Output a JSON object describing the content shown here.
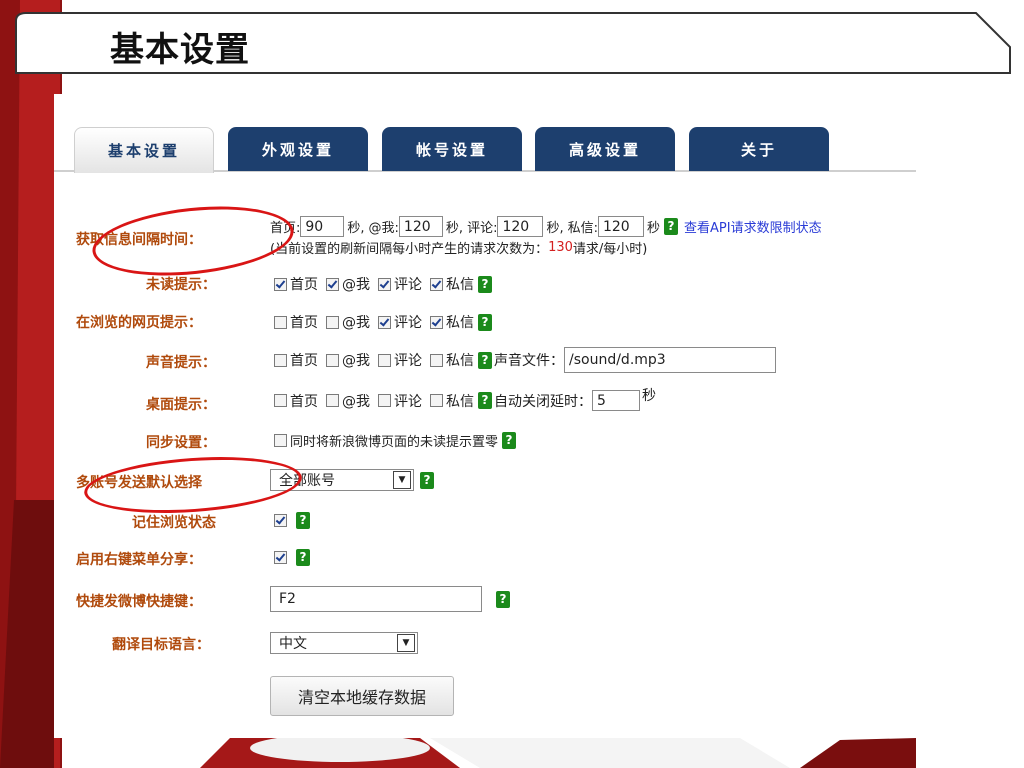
{
  "slide": {
    "title": "基本设置"
  },
  "tabs": [
    {
      "label": "基本设置",
      "active": true
    },
    {
      "label": "外观设置",
      "active": false
    },
    {
      "label": "帐号设置",
      "active": false
    },
    {
      "label": "高级设置",
      "active": false
    },
    {
      "label": "关于",
      "active": false
    }
  ],
  "interval": {
    "label": "获取信息间隔时间：",
    "home_label": "首页:",
    "home_value": "90",
    "sec1": "秒,",
    "mention_label": "@我:",
    "mention_value": "120",
    "sec2": "秒,",
    "comment_label": "评论:",
    "comment_value": "120",
    "sec3": "秒,",
    "dm_label": "私信:",
    "dm_value": "120",
    "sec4": "秒",
    "api_link": "查看API请求数限制状态",
    "note_prefix": "(当前设置的刷新间隔每小时产生的请求次数为：",
    "note_count": "130",
    "note_suffix": "请求/每小时)"
  },
  "unread": {
    "label": "未读提示：",
    "items": [
      {
        "label": "首页",
        "checked": true
      },
      {
        "label": "@我",
        "checked": true
      },
      {
        "label": "评论",
        "checked": true
      },
      {
        "label": "私信",
        "checked": true
      }
    ]
  },
  "browse": {
    "label": "在浏览的网页提示：",
    "items": [
      {
        "label": "首页",
        "checked": false
      },
      {
        "label": "@我",
        "checked": false
      },
      {
        "label": "评论",
        "checked": true
      },
      {
        "label": "私信",
        "checked": true
      }
    ]
  },
  "sound": {
    "label": "声音提示：",
    "items": [
      {
        "label": "首页",
        "checked": false
      },
      {
        "label": "@我",
        "checked": false
      },
      {
        "label": "评论",
        "checked": false
      },
      {
        "label": "私信",
        "checked": false
      }
    ],
    "file_label": "声音文件：",
    "file_value": "/sound/d.mp3"
  },
  "desktop": {
    "label": "桌面提示：",
    "items": [
      {
        "label": "首页",
        "checked": false
      },
      {
        "label": "@我",
        "checked": false
      },
      {
        "label": "评论",
        "checked": false
      },
      {
        "label": "私信",
        "checked": false
      }
    ],
    "delay_label": "自动关闭延时：",
    "delay_value": "5",
    "delay_unit": "秒"
  },
  "sync": {
    "label": "同步设置：",
    "option": "同时将新浪微博页面的未读提示置零",
    "checked": false
  },
  "multi_account": {
    "label": "多账号发送默认选择",
    "selected": "全部账号"
  },
  "remember": {
    "label": "记住浏览状态",
    "checked": true
  },
  "context_menu": {
    "label": "启用右键菜单分享：",
    "checked": true
  },
  "shortcut": {
    "label": "快捷发微博快捷键：",
    "value": "F2"
  },
  "language": {
    "label": "翻译目标语言：",
    "selected": "中文"
  },
  "clear_cache": {
    "label": "清空本地缓存数据"
  },
  "help_glyph": "?",
  "colors": {
    "tab_blue": "#1d3f6e",
    "label_orange": "#b04a0c",
    "help_green": "#1b8a1b",
    "highlight_red": "#d91515",
    "deco_red": "#8e1212"
  }
}
